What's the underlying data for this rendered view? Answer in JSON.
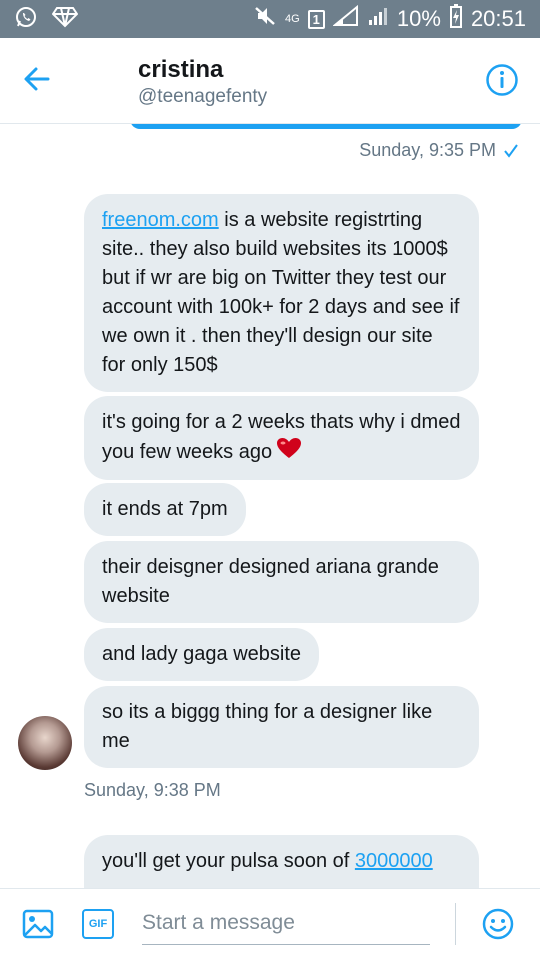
{
  "status_bar": {
    "network": "4G",
    "sim": "1",
    "battery": "10%",
    "time": "20:51"
  },
  "header": {
    "name": "cristina",
    "handle": "@teenagefenty"
  },
  "chat": {
    "sent_timestamp": "Sunday, 9:35 PM",
    "messages": [
      {
        "link": "freenom.com",
        "text": " is a website registrting site.. they also build websites its 1000$ but if wr are big on Twitter they test our account with 100k+ for 2 days and see if we own it .  then they'll design our site for only 150$"
      },
      {
        "text": "it's going for a 2 weeks thats why i dmed you few weeks ago"
      },
      {
        "text": "it ends at 7pm"
      },
      {
        "text": "their deisgner designed ariana grande website"
      },
      {
        "text": "and lady gaga website"
      },
      {
        "text": "so its a biggg thing for a designer like me"
      }
    ],
    "received_timestamp": "Sunday, 9:38 PM",
    "last_message": {
      "text": "you'll get your pulsa soon of ",
      "link": "3000000"
    }
  },
  "composer": {
    "placeholder": "Start a message",
    "gif_label": "GIF"
  },
  "colors": {
    "accent": "#1da1f2",
    "bubble_received": "#e6ecf0",
    "status_bar": "#6e7f8c"
  }
}
